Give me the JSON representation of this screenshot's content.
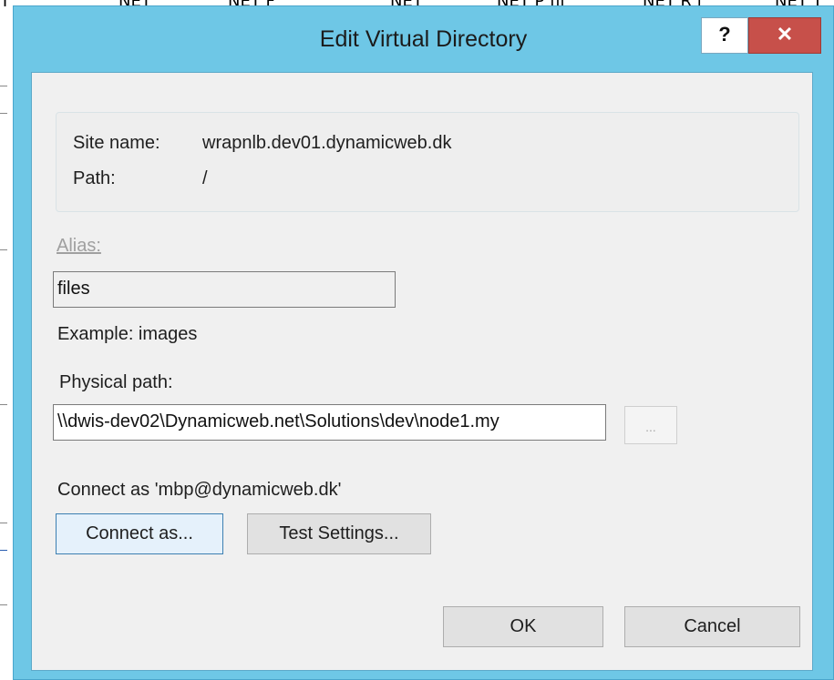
{
  "dialog": {
    "title": "Edit Virtual Directory",
    "help_label": "?",
    "close_label": "✕"
  },
  "info": {
    "site_name_label": "Site name:",
    "site_name_value": "wrapnlb.dev01.dynamicweb.dk",
    "path_label": "Path:",
    "path_value": "/"
  },
  "alias": {
    "label": "Alias:",
    "value": "files",
    "example": "Example: images"
  },
  "physical_path": {
    "label": "Physical path:",
    "value": "\\\\dwis-dev02\\Dynamicweb.net\\Solutions\\dev\\node1.my",
    "browse_label": "..."
  },
  "connect": {
    "status": "Connect as 'mbp@dynamicweb.dk'",
    "connect_as_label": "Connect as...",
    "test_settings_label": "Test Settings..."
  },
  "footer": {
    "ok_label": "OK",
    "cancel_label": "Cancel"
  },
  "background": {
    "column_headers": [
      "T",
      "NET",
      "NET F",
      "NET",
      "NET P fil",
      "NET R l",
      "NET T"
    ]
  },
  "colors": {
    "titlebar": "#6ec7e6",
    "close_button": "#c7504a",
    "client_background": "#f0f0f0"
  }
}
